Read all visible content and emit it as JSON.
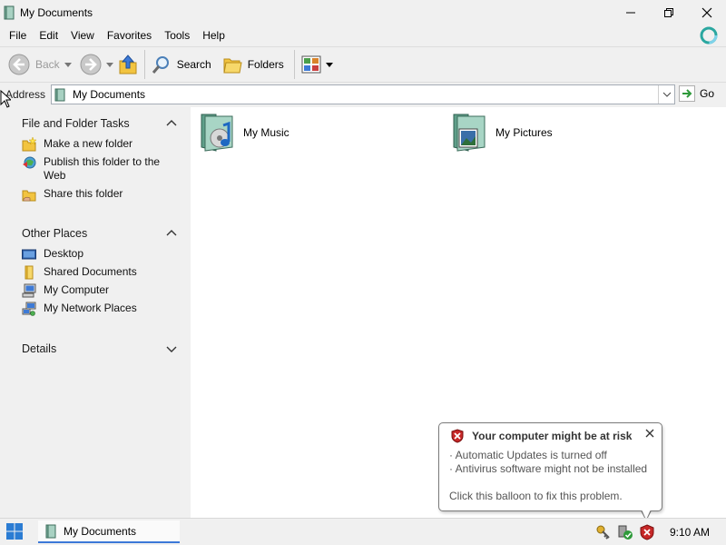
{
  "window": {
    "title": "My Documents"
  },
  "menu": [
    "File",
    "Edit",
    "View",
    "Favorites",
    "Tools",
    "Help"
  ],
  "toolbar": {
    "back": "Back",
    "search": "Search",
    "folders": "Folders"
  },
  "address": {
    "label": "Address",
    "value": "My Documents",
    "go": "Go"
  },
  "tasks": {
    "file_folder": {
      "title": "File and Folder Tasks",
      "items": [
        "Make a new folder",
        "Publish this folder to the Web",
        "Share this folder"
      ]
    },
    "other_places": {
      "title": "Other Places",
      "items": [
        "Desktop",
        "Shared Documents",
        "My Computer",
        "My Network Places"
      ]
    },
    "details": {
      "title": "Details"
    }
  },
  "folders": [
    "My Music",
    "My Pictures"
  ],
  "balloon": {
    "title": "Your computer might be at risk",
    "line1": "· Automatic Updates is turned off",
    "line2": "· Antivirus software might not be installed",
    "line3": "Click this balloon to fix this problem."
  },
  "taskbar": {
    "window_label": "My Documents",
    "clock": "9:10 AM"
  },
  "colors": {
    "accent": "#3c78d8",
    "alert_red": "#c62828",
    "go_green": "#2e9a3a",
    "folder_yellow": "#f2c440"
  }
}
